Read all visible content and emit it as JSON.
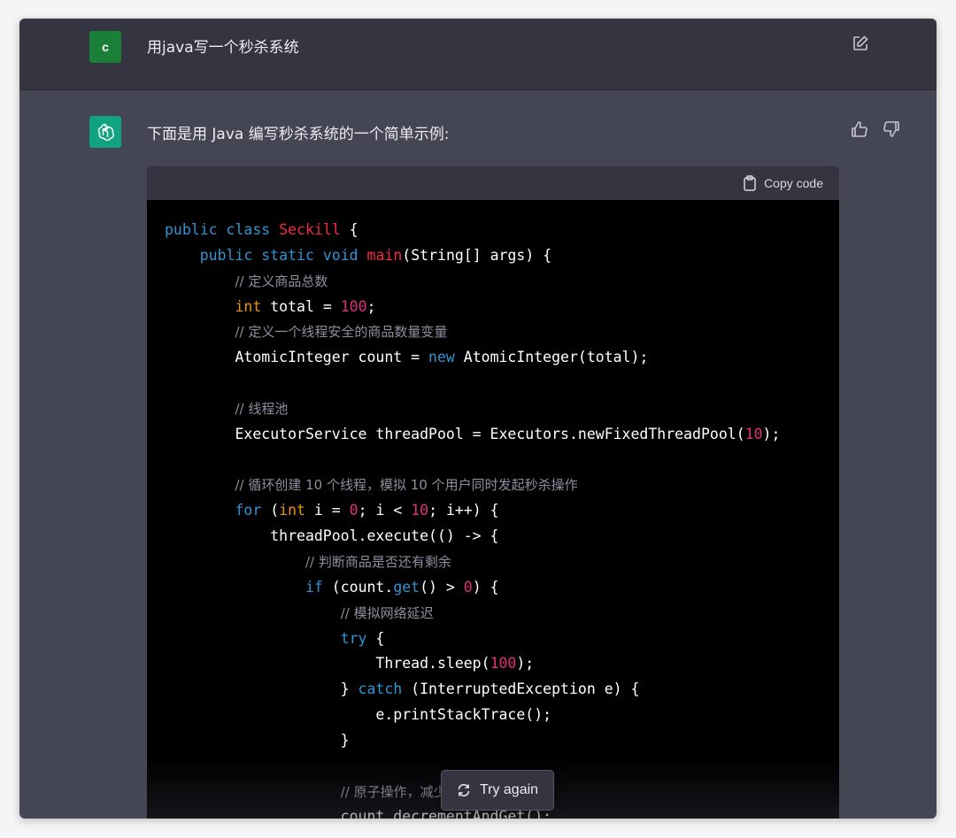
{
  "user": {
    "avatar_letter": "c",
    "avatar_color": "#1a7f37",
    "message": "用java写一个秒杀系统"
  },
  "assistant": {
    "avatar_color": "#10a37f",
    "message": "下面是用 Java 编写秒杀系统的一个简单示例:"
  },
  "code_block": {
    "copy_label": "Copy code",
    "language": "java"
  },
  "actions": {
    "try_again_label": "Try again"
  },
  "colors": {
    "keyword": "#2e95d3",
    "class_name": "#f22c3d",
    "number": "#df3079",
    "type": "#e9950c",
    "comment": "#8e8ea0"
  }
}
